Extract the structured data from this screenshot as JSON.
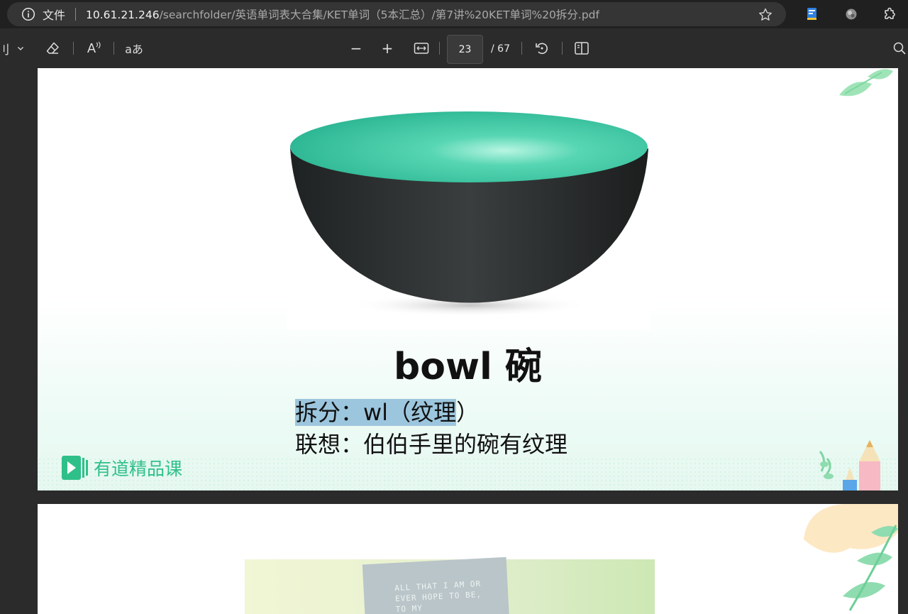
{
  "address_bar": {
    "security_label": "文件",
    "url_host": "10.61.21.246",
    "url_path": "/searchfolder/英语单词表大合集/KET单词（5本汇总）/第7讲%20KET单词%20拆分.pdf"
  },
  "toolbar": {
    "draw_label": "刂",
    "read_aloud_label": "A",
    "translate_label": "aあ",
    "zoom_out_label": "−",
    "zoom_in_label": "+",
    "current_page": "23",
    "total_pages": "/ 67"
  },
  "page1": {
    "title": "bowl 碗",
    "split_highlight": "拆分：wl（纹理",
    "split_rest": "）",
    "association": "联想：伯伯手里的碗有纹理",
    "brand": "有道精品课"
  },
  "page2": {
    "quote_lines": [
      "ALL THAT I AM OR",
      "EVER HOPE TO BE,",
      "TO MY"
    ]
  },
  "colors": {
    "bowl_inner": "#3fc9a5",
    "bowl_outer": "#252828",
    "brand_green": "#2fc08a",
    "highlight": "#9cc6dd"
  }
}
